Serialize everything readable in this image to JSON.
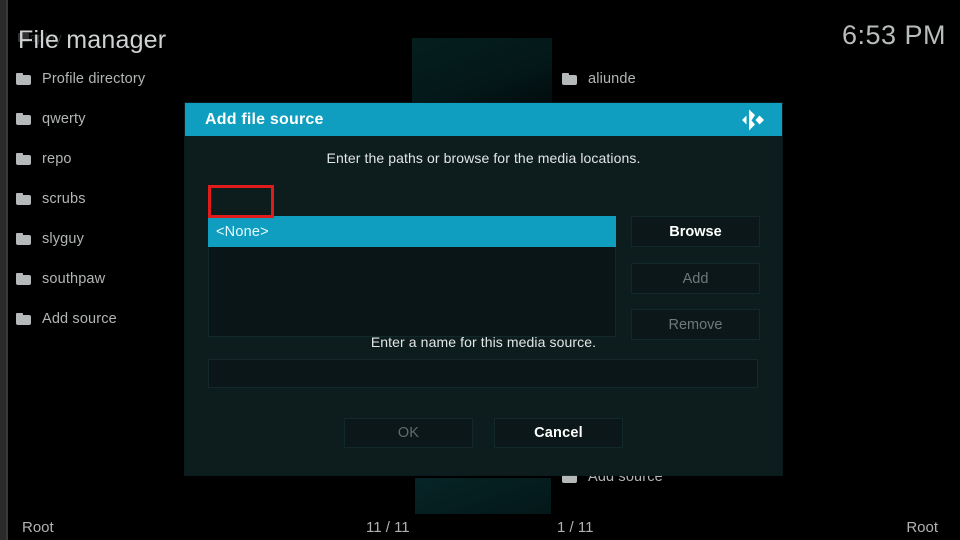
{
  "app": {
    "window_title": "File manager",
    "ghost_text": "aaplay",
    "clock": "6:53 PM"
  },
  "left_column": {
    "items": [
      {
        "label": "Profile directory",
        "icon": "folder-icon"
      },
      {
        "label": "qwerty",
        "icon": "folder-icon"
      },
      {
        "label": "repo",
        "icon": "folder-icon"
      },
      {
        "label": "scrubs",
        "icon": "folder-icon"
      },
      {
        "label": "slyguy",
        "icon": "folder-icon"
      },
      {
        "label": "southpaw",
        "icon": "folder-icon"
      },
      {
        "label": "Add source",
        "icon": "folder-icon"
      }
    ]
  },
  "right_column": {
    "items": [
      {
        "label": "aliunde",
        "icon": "folder-icon"
      },
      {
        "label": "Add source",
        "icon": "folder-icon"
      }
    ]
  },
  "status_bar": {
    "left_path": "Root",
    "left_count": "11 / 11",
    "right_count": "1 / 11",
    "right_path": "Root"
  },
  "dialog": {
    "title": "Add file source",
    "logo_icon": "kodi-logo-icon",
    "paths_hint": "Enter the paths or browse for the media locations.",
    "name_hint": "Enter a name for this media source.",
    "path_list": [
      {
        "label": "<None>",
        "selected": true
      }
    ],
    "name_value": "",
    "name_placeholder": "",
    "side_buttons": [
      {
        "label": "Browse",
        "state": "enabled"
      },
      {
        "label": "Add",
        "state": "disabled"
      },
      {
        "label": "Remove",
        "state": "disabled"
      }
    ],
    "footer_buttons": [
      {
        "label": "OK",
        "state": "disabled"
      },
      {
        "label": "Cancel",
        "state": "enabled"
      }
    ]
  },
  "colors": {
    "accent": "#0f9dc0",
    "dialog_bg": "#0d1c1d",
    "highlight_box": "#e01b1b",
    "text_primary": "#ffffff",
    "text_muted": "#b2b5b6",
    "text_disabled": "#6d7a7b"
  }
}
